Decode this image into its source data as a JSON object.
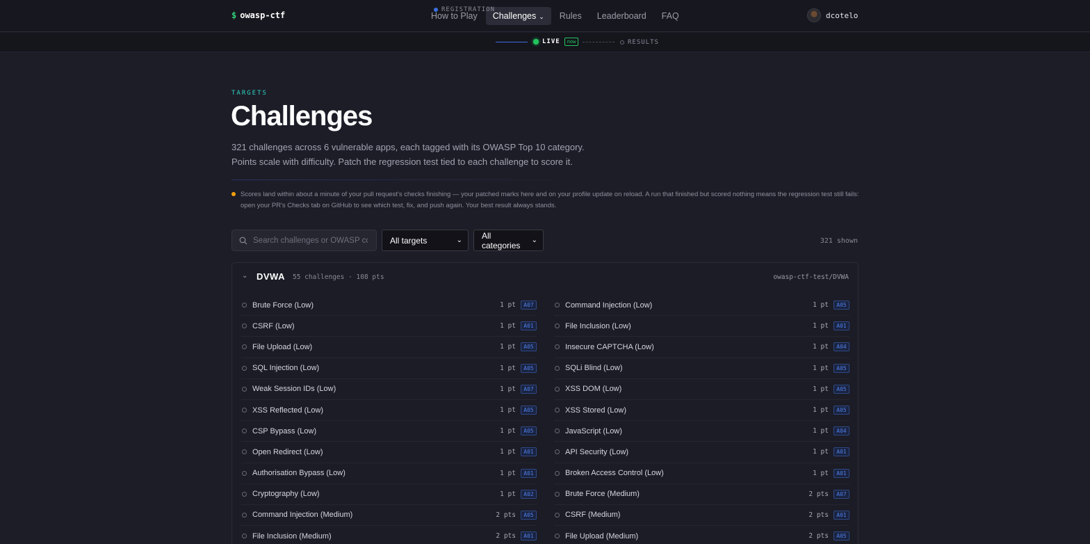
{
  "brand": {
    "symbol": "$",
    "name": "owasp-ctf"
  },
  "nav": {
    "items": [
      {
        "label": "How to Play"
      },
      {
        "label": "Challenges",
        "active": true
      },
      {
        "label": "Rules"
      },
      {
        "label": "Leaderboard"
      },
      {
        "label": "FAQ"
      }
    ],
    "user": "dcotelo"
  },
  "phases": {
    "registration": "REGISTRATION",
    "live": "LIVE",
    "live_badge": "now",
    "results": "RESULTS"
  },
  "header": {
    "eyebrow": "TARGETS",
    "title": "Challenges",
    "description": "321 challenges across 6 vulnerable apps, each tagged with its OWASP Top 10 category. Points scale with difficulty. Patch the regression test tied to each challenge to score it.",
    "note": "Scores land within about a minute of your pull request's checks finishing — your patched marks here and on your profile update on reload. A run that finished but scored nothing means the regression test still fails: open your PR's Checks tab on GitHub to see which test, fix, and push again. Your best result always stands."
  },
  "filters": {
    "search_placeholder": "Search challenges or OWASP co",
    "target": "All targets",
    "category": "All categories",
    "shown": "321 shown"
  },
  "group": {
    "name": "DVWA",
    "meta": "55 challenges · 108 pts",
    "repo": "owasp-ctf-test/DVWA",
    "left": [
      {
        "name": "Brute Force (Low)",
        "pts": "1 pt",
        "cat": "A07"
      },
      {
        "name": "CSRF (Low)",
        "pts": "1 pt",
        "cat": "A01"
      },
      {
        "name": "File Upload (Low)",
        "pts": "1 pt",
        "cat": "A05"
      },
      {
        "name": "SQL Injection (Low)",
        "pts": "1 pt",
        "cat": "A05"
      },
      {
        "name": "Weak Session IDs (Low)",
        "pts": "1 pt",
        "cat": "A07"
      },
      {
        "name": "XSS Reflected (Low)",
        "pts": "1 pt",
        "cat": "A05"
      },
      {
        "name": "CSP Bypass (Low)",
        "pts": "1 pt",
        "cat": "A05"
      },
      {
        "name": "Open Redirect (Low)",
        "pts": "1 pt",
        "cat": "A01"
      },
      {
        "name": "Authorisation Bypass (Low)",
        "pts": "1 pt",
        "cat": "A01"
      },
      {
        "name": "Cryptography (Low)",
        "pts": "1 pt",
        "cat": "A02"
      },
      {
        "name": "Command Injection (Medium)",
        "pts": "2 pts",
        "cat": "A05"
      },
      {
        "name": "File Inclusion (Medium)",
        "pts": "2 pts",
        "cat": "A01"
      }
    ],
    "right": [
      {
        "name": "Command Injection (Low)",
        "pts": "1 pt",
        "cat": "A05"
      },
      {
        "name": "File Inclusion (Low)",
        "pts": "1 pt",
        "cat": "A01"
      },
      {
        "name": "Insecure CAPTCHA (Low)",
        "pts": "1 pt",
        "cat": "A04"
      },
      {
        "name": "SQLi Blind (Low)",
        "pts": "1 pt",
        "cat": "A05"
      },
      {
        "name": "XSS DOM (Low)",
        "pts": "1 pt",
        "cat": "A05"
      },
      {
        "name": "XSS Stored (Low)",
        "pts": "1 pt",
        "cat": "A05"
      },
      {
        "name": "JavaScript (Low)",
        "pts": "1 pt",
        "cat": "A04"
      },
      {
        "name": "API Security (Low)",
        "pts": "1 pt",
        "cat": "A01"
      },
      {
        "name": "Broken Access Control (Low)",
        "pts": "1 pt",
        "cat": "A01"
      },
      {
        "name": "Brute Force (Medium)",
        "pts": "2 pts",
        "cat": "A07"
      },
      {
        "name": "CSRF (Medium)",
        "pts": "2 pts",
        "cat": "A01"
      },
      {
        "name": "File Upload (Medium)",
        "pts": "2 pts",
        "cat": "A05"
      }
    ]
  }
}
